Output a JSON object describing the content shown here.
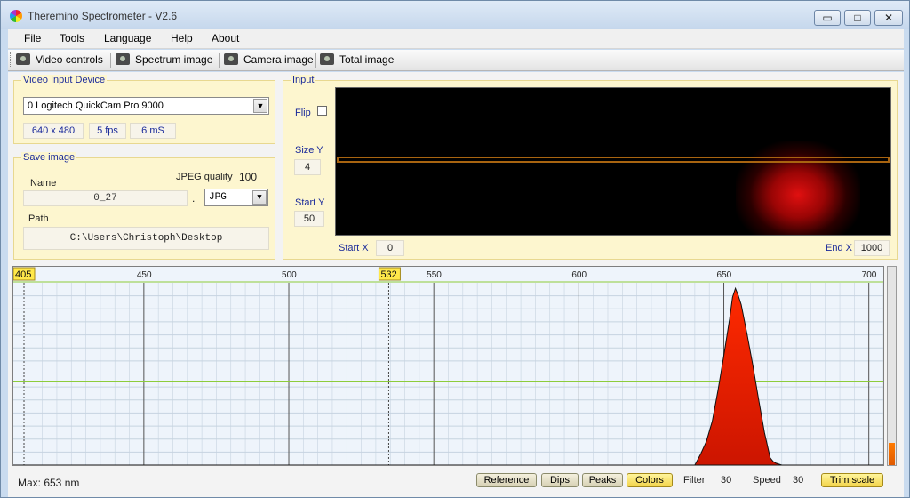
{
  "window": {
    "title": "Theremino Spectrometer - V2.6",
    "min_glyph": "▭",
    "max_glyph": "□",
    "close_glyph": "✕"
  },
  "menu": [
    "File",
    "Tools",
    "Language",
    "Help",
    "About"
  ],
  "toolbar": [
    {
      "label": "Video controls",
      "icon": "video-camera-icon"
    },
    {
      "label": "Spectrum image",
      "icon": "camera-icon"
    },
    {
      "label": "Camera image",
      "icon": "camera-icon"
    },
    {
      "label": "Total image",
      "icon": "camera-icon"
    }
  ],
  "video_input": {
    "title": "Video Input Device",
    "device": "0 Logitech QuickCam Pro 9000",
    "resolution": "640 x 480",
    "fps": "5 fps",
    "exposure": "6 mS"
  },
  "save_image": {
    "title": "Save image",
    "name_label": "Name",
    "jpeg_quality_label": "JPEG quality",
    "jpeg_quality": "100",
    "name_value": "0_27",
    "dot": ".",
    "format": "JPG",
    "path_label": "Path",
    "path_value": "C:\\Users\\Christoph\\Desktop"
  },
  "input": {
    "title": "Input",
    "flip_label": "Flip",
    "flip_checked": false,
    "size_y_label": "Size Y",
    "size_y": "4",
    "start_y_label": "Start Y",
    "start_y": "50",
    "start_x_label": "Start X",
    "start_x": "0",
    "end_x_label": "End X",
    "end_x": "1000"
  },
  "chart_data": {
    "type": "area",
    "x_range": [
      405,
      705
    ],
    "y_range": [
      0,
      100
    ],
    "tick_labels": [
      450,
      500,
      550,
      600,
      650,
      700
    ],
    "markers": [
      405,
      532
    ],
    "series": [
      {
        "x": [
          405,
          600,
          640,
          642,
          644,
          646,
          648,
          650,
          652,
          653,
          654,
          655,
          656,
          658,
          660,
          662,
          664,
          666,
          667,
          668,
          670,
          705
        ],
        "y": [
          0,
          0,
          0,
          6,
          13,
          24,
          41,
          60,
          80,
          92,
          97,
          93,
          88,
          72,
          55,
          36,
          18,
          4,
          2,
          1,
          0,
          0
        ]
      }
    ],
    "colors": {
      "peak": "#ff2a00",
      "low": "#cc1500",
      "background": "#eef4fb",
      "grid": "#c6d3e0",
      "midline": "#8dcc3a"
    }
  },
  "status": {
    "max_label": "Max: 653 nm",
    "buttons": [
      "Reference",
      "Dips",
      "Peaks",
      "Colors"
    ],
    "active_button": "Colors",
    "filter_label": "Filter",
    "filter": "30",
    "speed_label": "Speed",
    "speed": "30",
    "trim_label": "Trim scale"
  }
}
